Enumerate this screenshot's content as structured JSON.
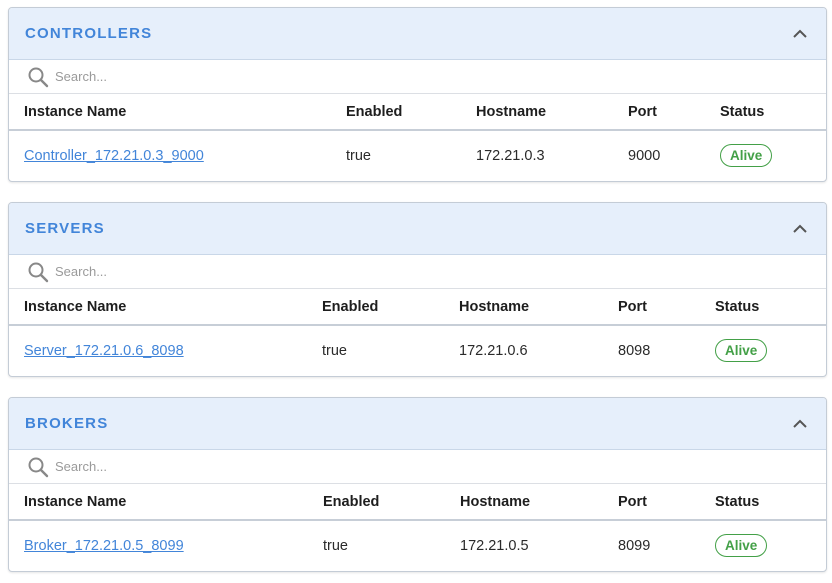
{
  "panels": [
    {
      "title": "CONTROLLERS",
      "search": {
        "placeholder": "Search..."
      },
      "columns": [
        "Instance Name",
        "Enabled",
        "Hostname",
        "Port",
        "Status"
      ],
      "rows": [
        {
          "instance_name": "Controller_172.21.0.3_9000",
          "enabled": "true",
          "hostname": "172.21.0.3",
          "port": "9000",
          "status": "Alive"
        }
      ]
    },
    {
      "title": "SERVERS",
      "search": {
        "placeholder": "Search..."
      },
      "columns": [
        "Instance Name",
        "Enabled",
        "Hostname",
        "Port",
        "Status"
      ],
      "rows": [
        {
          "instance_name": "Server_172.21.0.6_8098",
          "enabled": "true",
          "hostname": "172.21.0.6",
          "port": "8098",
          "status": "Alive"
        }
      ]
    },
    {
      "title": "BROKERS",
      "search": {
        "placeholder": "Search..."
      },
      "columns": [
        "Instance Name",
        "Enabled",
        "Hostname",
        "Port",
        "Status"
      ],
      "rows": [
        {
          "instance_name": "Broker_172.21.0.5_8099",
          "enabled": "true",
          "hostname": "172.21.0.5",
          "port": "8099",
          "status": "Alive"
        }
      ]
    }
  ],
  "icons": {
    "collapse": "chevron-up-icon",
    "search": "search-icon"
  },
  "colors": {
    "accent": "#4285d9",
    "header_bg": "#e6effb",
    "alive": "#43a047"
  }
}
